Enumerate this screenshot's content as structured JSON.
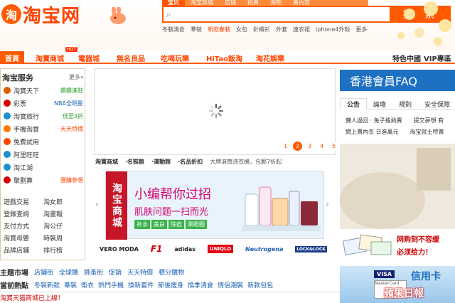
{
  "header": {
    "logo_text": "淘宝网",
    "search_tabs": [
      "宝贝",
      "淘宝商城",
      "店铺",
      "拍賣",
      "淘吧",
      "賣內容"
    ],
    "search_button": "搜 索",
    "hot_words": [
      "冬裝清倉",
      "羣裝",
      "新款春裝",
      "女包",
      "針織衫",
      "外套",
      "連衣裙",
      "iphone4外殼",
      "更多"
    ]
  },
  "nav": {
    "home": "首頁",
    "items": [
      "淘寶商城",
      "電器城",
      "無名良品",
      "吃喝玩樂",
      "HiTao飯淘",
      "淘花娛樂",
      "特色中國",
      "VIP專區"
    ],
    "hot_badge": "HOT"
  },
  "sidebar": {
    "title": "淘宝服务",
    "more": "更多»",
    "rows": [
      {
        "label": "淘寶天下",
        "tag": "鑽鑽進駐",
        "tag_color": "#2a9d2a",
        "icon": "calendar-icon",
        "icon_color": "#e05a00"
      },
      {
        "label": "彩票",
        "tag": "NBA全明星",
        "tag_color": "#1a5fb4",
        "icon": "lottery-icon",
        "icon_color": "#d40000"
      },
      {
        "label": "淘寶旅行",
        "tag": "低至3折",
        "tag_color": "#2a9d2a",
        "icon": "plane-icon",
        "icon_color": "#1a8fd1"
      },
      {
        "label": "手機淘寶",
        "tag": "天天特價",
        "tag_color": "#ff4400",
        "icon": "phone-icon",
        "icon_color": "#ff7700"
      },
      {
        "label": "免費試用",
        "tag": "",
        "tag_color": "#333333",
        "icon": "gift-icon",
        "icon_color": "#ff4400"
      },
      {
        "label": "阿里旺旺",
        "tag": "",
        "tag_color": "#333333",
        "icon": "chat-icon",
        "icon_color": "#1a8fd1"
      },
      {
        "label": "淘江湖",
        "tag": "",
        "tag_color": "#333333",
        "icon": "community-icon",
        "icon_color": "#1a8fd1"
      },
      {
        "label": "聚劃算",
        "tag": "團購參想",
        "tag_color": "#ff4400",
        "icon": "groupbuy-icon",
        "icon_color": "#d40000"
      }
    ],
    "grid": [
      [
        "遊戲交易",
        "淘女郎"
      ],
      [
        "登錄查詢",
        "淘畫報"
      ],
      [
        "支付方式",
        "淘公仔"
      ],
      [
        "淘寶母嬰",
        "時裝周"
      ],
      [
        "品牌店鋪",
        "排行榜"
      ]
    ]
  },
  "carousel": {
    "pages": [
      "1",
      "2",
      "3",
      "4",
      "5"
    ],
    "active_page": "2"
  },
  "mall_tabs": [
    "淘寶商城",
    "·名鞋館",
    "·運動館",
    "·名品折扣",
    "大牌滾筒洗衣機，包郵7折起"
  ],
  "promo": {
    "badge": "淘宝商城",
    "title": "小编帮你过招",
    "subtitle": "肌肤问题一扫而光",
    "tags": [
      "补水",
      "美白",
      "除痘",
      "黑眼圈"
    ]
  },
  "brands": [
    "VERO MODA",
    "F1",
    "adidas",
    "UNIQLO",
    "Neutrogena",
    "LOCK&LOCK"
  ],
  "right": {
    "faq_banner": "香港會員FAQ",
    "notice_tabs": [
      "公告",
      "論壇",
      "規則",
      "安全保障"
    ],
    "notices": [
      [
        "懶人過回 · 兔子搖熱賣",
        "提交夢想 有"
      ],
      [
        "網上賣內衣 日進萬元",
        "淘宝就士特賣"
      ]
    ],
    "ad_line1": "网购刻不容缓",
    "ad_line2": "必须给力！",
    "card_text": "信用卡",
    "visa": "VISA",
    "mastercard": "MasterCard"
  },
  "bottom": {
    "market_title": "主題市場",
    "market_links": [
      "店鋪街",
      "全球購",
      "跳蚤街",
      "促銷",
      "天天特價",
      "積分購物"
    ],
    "hot_title": "當前熱點",
    "hot_links": [
      "冬裝新款",
      "羣裝",
      "衛衣",
      "熱門手機",
      "換新套件",
      "節後瘦身",
      "換季清倉",
      "情侶潮裝",
      "新款包包"
    ],
    "cut_text": "淘寶天猫商城已上線！"
  },
  "watermark": "蘋果日報",
  "colors": {
    "brand": "#ff5a00",
    "brand_dark": "#ff4400",
    "blue": "#1e70c2"
  }
}
